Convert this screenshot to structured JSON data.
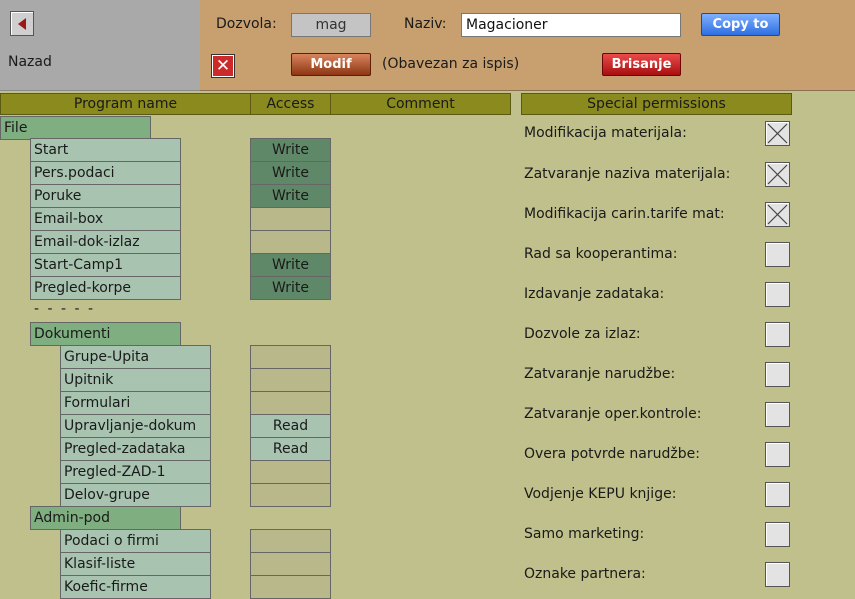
{
  "header": {
    "back_label": "Nazad",
    "dozvola_label": "Dozvola:",
    "dozvola_value": "mag",
    "naziv_label": "Naziv:",
    "naziv_value": "Magacioner",
    "copy_label": "Copy to",
    "modif_label": "Modif",
    "obavezan_label": "(Obavezan za ispis)",
    "brisanje_label": "Brisanje"
  },
  "table": {
    "headers": {
      "program": "Program name",
      "access": "Access",
      "comment": "Comment",
      "special": "Special permissions"
    },
    "file_label": "File",
    "file_items": [
      {
        "name": "Start",
        "access": "Write"
      },
      {
        "name": "Pers.podaci",
        "access": "Write"
      },
      {
        "name": "Poruke",
        "access": "Write"
      },
      {
        "name": "Email-box",
        "access": ""
      },
      {
        "name": "Email-dok-izlaz",
        "access": ""
      },
      {
        "name": "Start-Camp1",
        "access": "Write"
      },
      {
        "name": "Pregled-korpe",
        "access": "Write"
      }
    ],
    "separator": "- - - - -",
    "dokumenti_label": "Dokumenti",
    "dokumenti_items": [
      {
        "name": "Grupe-Upita",
        "access": ""
      },
      {
        "name": "Upitnik",
        "access": ""
      },
      {
        "name": "Formulari",
        "access": ""
      },
      {
        "name": "Upravljanje-dokum",
        "access": "Read"
      },
      {
        "name": "Pregled-zadataka",
        "access": "Read"
      },
      {
        "name": "Pregled-ZAD-1",
        "access": ""
      },
      {
        "name": "Delov-grupe",
        "access": ""
      }
    ],
    "adminpod_label": "Admin-pod",
    "adminpod_items": [
      {
        "name": "Podaci o firmi",
        "access": ""
      },
      {
        "name": "Klasif-liste",
        "access": ""
      },
      {
        "name": "Koefic-firme",
        "access": ""
      }
    ]
  },
  "permissions": [
    {
      "label": "Modifikacija materijala:",
      "checked": true
    },
    {
      "label": "Zatvaranje naziva materijala:",
      "checked": true
    },
    {
      "label": "Modifikacija carin.tarife mat:",
      "checked": true
    },
    {
      "label": "Rad sa kooperantima:",
      "checked": false
    },
    {
      "label": "Izdavanje zadataka:",
      "checked": false
    },
    {
      "label": "Dozvole za izlaz:",
      "checked": false
    },
    {
      "label": "Zatvaranje narudžbe:",
      "checked": false
    },
    {
      "label": "Zatvaranje oper.kontrole:",
      "checked": false
    },
    {
      "label": "Overa potvrde narudžbe:",
      "checked": false
    },
    {
      "label": "Vodjenje KEPU knjige:",
      "checked": false
    },
    {
      "label": "Samo marketing:",
      "checked": false
    },
    {
      "label": "Oznake partnera:",
      "checked": false
    }
  ]
}
